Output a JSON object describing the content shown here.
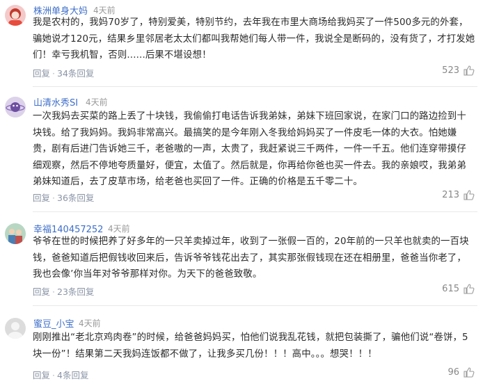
{
  "comments": [
    {
      "username": "株洲单身大妈",
      "time": "4天前",
      "text": "我是农村的，我妈70岁了，特别爱美，特别节约，去年我在市里大商场给我妈买了一件500多元的外套，骗她说才120元，结果乡里邻居老太太们都叫我帮她们每人带一件，我说全是断码的，没有货了，才打发她们！幸亏我机智，否则......后果不堪设想！",
      "reply_label": "回复",
      "replies_label": "34条回复",
      "likes": "523",
      "avatar_icon": "avatar-pink-girl"
    },
    {
      "username": "山清水秀SI",
      "time": "4天前",
      "text": "一次我妈去买菜的路上丢了十块钱，我偷偷打电话告诉我弟妹，弟妹下班回家说，在家门口的路边捡到十块钱。给了我妈妈。我妈非常高兴。最搞笑的是今年刚入冬我给妈妈买了一件皮毛一体的大衣。怕她嫌贵，剧有后进门告诉她三千，老爸嗷的一声，太贵了，我赶紧说三千两件，一件一千五。他们连穿带摸仔细观察，然后不停地夸质量好，便宜，太值了。然后就是，你再给你爸也买一件去。我的亲娘哎，我弟弟弟妹知道后，去了皮草市场，给老爸也买回了一件。正确的价格是五千零二十。",
      "reply_label": "回复",
      "replies_label": "36条回复",
      "likes": "213",
      "avatar_icon": "avatar-planet"
    },
    {
      "username": "幸福140457252",
      "time": "4天前",
      "text": "爷爷在世的时候把养了好多年的一只羊卖掉过年，收到了一张假一百的，20年前的一只羊也就卖的一百块钱，爸爸知道后把假钱收回来后，告诉爷爷钱花出去了，其实那张假钱现在还在相册里，爸爸当你老了，我也会像’你当年对爷爷那样对你。为天下的爸爸致敬。",
      "reply_label": "回复",
      "replies_label": "23条回复",
      "likes": "615",
      "avatar_icon": "avatar-children"
    },
    {
      "username": "蜜豆_小宝",
      "time": "4天前",
      "text": "刚刚推出“老北京鸡肉卷”的时候，给爸爸妈妈买，怕他们说我乱花钱，就把包装撕了，骗他们说“卷饼，5块一份”！结果第二天我妈连饭都不做了，让我多买几份！！！高中。。。想哭！！！",
      "reply_label": "回复",
      "replies_label": "4条回复",
      "likes": "96",
      "avatar_icon": "avatar-default"
    }
  ]
}
